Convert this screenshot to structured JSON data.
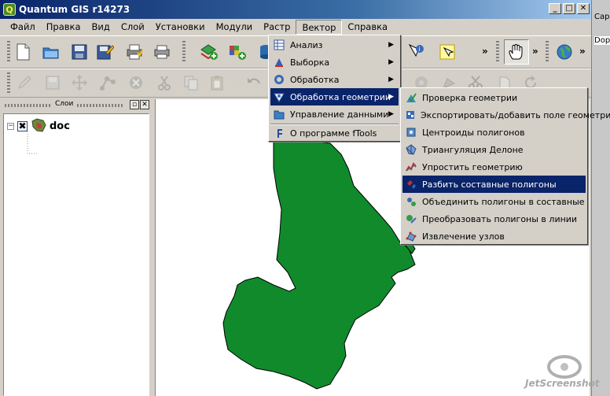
{
  "window": {
    "title": "Quantum GIS r14273",
    "app_icon_glyph": "Q",
    "minimize": "_",
    "maximize": "□",
    "close": "✕"
  },
  "menubar": {
    "items": [
      {
        "label": "Файл"
      },
      {
        "label": "Правка"
      },
      {
        "label": "Вид"
      },
      {
        "label": "Слой"
      },
      {
        "label": "Установки"
      },
      {
        "label": "Модули"
      },
      {
        "label": "Растр"
      },
      {
        "label": "Вектор"
      },
      {
        "label": "Справка"
      }
    ],
    "open_menu": "Вектор"
  },
  "vector_menu": {
    "items": [
      {
        "label": "Анализ",
        "icon": "analysis-icon",
        "submenu": true
      },
      {
        "label": "Выборка",
        "icon": "sampling-icon",
        "submenu": true
      },
      {
        "label": "Обработка",
        "icon": "processing-icon",
        "submenu": true
      },
      {
        "label": "Обработка геометрии",
        "icon": "geometry-icon",
        "submenu": true,
        "highlighted": true
      },
      {
        "label": "Управление данными",
        "icon": "data-management-icon",
        "submenu": true
      },
      {
        "label": "О программе fTools",
        "icon": "about-icon",
        "submenu": false
      }
    ]
  },
  "geometry_submenu": {
    "items": [
      {
        "label": "Проверка геометрии",
        "icon": "check-geometry-icon"
      },
      {
        "label": "Экспортировать/добавить поле геометрии",
        "icon": "export-geometry-icon"
      },
      {
        "label": "Центроиды полигонов",
        "icon": "centroids-icon"
      },
      {
        "label": "Триангуляция Делоне",
        "icon": "delaunay-icon"
      },
      {
        "label": "Упростить геометрию",
        "icon": "simplify-icon"
      },
      {
        "label": "Разбить составные полигоны",
        "icon": "multipart-split-icon",
        "highlighted": true
      },
      {
        "label": "Объединить полигоны в составные",
        "icon": "singleparts-merge-icon"
      },
      {
        "label": "Преобразовать полигоны в линии",
        "icon": "polygons-to-lines-icon"
      },
      {
        "label": "Извлечение узлов",
        "icon": "extract-nodes-icon"
      }
    ]
  },
  "layers_panel": {
    "title": "Слои",
    "layers": [
      {
        "name": "doc",
        "visible": true,
        "expanded": true,
        "fill_color": "#118a2c"
      }
    ]
  },
  "right_strip": {
    "peek_top": "Cap",
    "peek_second": "Dopy"
  },
  "watermark": {
    "text": "JetScreenshot"
  },
  "colors": {
    "polygon_fill": "#118a2c",
    "menu_highlight": "#0a246a",
    "titlebar": "#0a246a"
  }
}
